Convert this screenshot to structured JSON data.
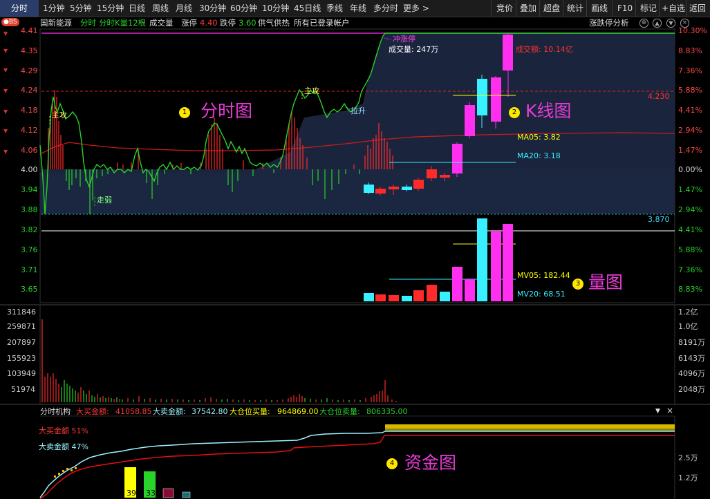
{
  "toolbar": {
    "periods": [
      "分时",
      "1分钟",
      "5分钟",
      "15分钟",
      "日线",
      "周线",
      "月线",
      "30分钟",
      "60分钟",
      "10分钟",
      "45日线",
      "季线",
      "年线",
      "多分时",
      "更多 >"
    ],
    "tools": [
      "竞价",
      "叠加",
      "超盘",
      "统计",
      "画线",
      "F10",
      "标记",
      "+自选",
      "返回"
    ]
  },
  "info": {
    "badge": "●BS",
    "name": "国新能源",
    "mode": "分时",
    "kline_count": "分时K量12根",
    "volume_label": "成交量",
    "limit_up_label": "涨停",
    "limit_up_value": "4.40",
    "limit_down_label": "跌停",
    "limit_down_value": "3.60",
    "supply_demand": "供气供热",
    "account": "所有已登录帐户",
    "right_tool": "涨跌停分析",
    "right_icons": [
      "gear-icon",
      "up-icon",
      "down-icon",
      "close-icon"
    ]
  },
  "price_axis": {
    "left": [
      "4.41",
      "4.35",
      "4.29",
      "4.24",
      "4.18",
      "4.12",
      "4.06",
      "4.00",
      "3.94",
      "3.88",
      "3.82",
      "3.76",
      "3.71",
      "3.65"
    ],
    "right": [
      "10.30%",
      "8.83%",
      "7.36%",
      "5.88%",
      "4.41%",
      "2.94%",
      "1.47%",
      "0.00%",
      "1.47%",
      "2.94%",
      "4.41%",
      "5.88%",
      "7.36%",
      "8.83%"
    ]
  },
  "volume_axis": {
    "left": [
      "311846",
      "259871",
      "207897",
      "155923",
      "103949",
      "51974"
    ],
    "right": [
      "1.2亿",
      "1.0亿",
      "8191万",
      "6143万",
      "4096万",
      "2048万"
    ]
  },
  "annotations": {
    "zhugong1": "主攻",
    "zouruo": "走弱",
    "zhugong2": "主攻",
    "lasheng": "拉升",
    "chongzhangting": "冲涨停",
    "volume_text": "成交量: 247万",
    "amount_text": "成交额: 10.14亿",
    "price_line_label": "4.230",
    "low_line_label": "3.870",
    "ma05": "MA05: 3.82",
    "ma20": "MA20: 3.18",
    "mv05": "MV05: 182.44",
    "mv20": "MV20: 68.51"
  },
  "labels": {
    "n1": "1",
    "t1": "分时图",
    "n2": "2",
    "t2": "K线图",
    "n3": "3",
    "t3": "量图",
    "n4": "4",
    "t4": "资金图"
  },
  "fund_panel": {
    "title": "分时机构",
    "big_buy_label": "大买金额:",
    "big_buy_value": "41058.85",
    "big_sell_label": "大卖金额:",
    "big_sell_value": "37542.80",
    "pos_buy_label": "大仓位买量:",
    "pos_buy_value": "964869.00",
    "pos_sell_label": "大仓位卖量:",
    "pos_sell_value": "806335.00",
    "legend_buy": "大买金额  51%",
    "legend_sell": "大卖金额  47%",
    "bar_values": [
      "39",
      "33",
      "",
      ""
    ],
    "axis_right": [
      "2.5万",
      "1.2万"
    ]
  },
  "colors": {
    "up": "#ff2a2a",
    "down": "#29d329",
    "cyan": "#38f0ff",
    "magenta": "#ff2ff0",
    "yellow": "#ffff00",
    "accent": "#2c3c68"
  }
}
